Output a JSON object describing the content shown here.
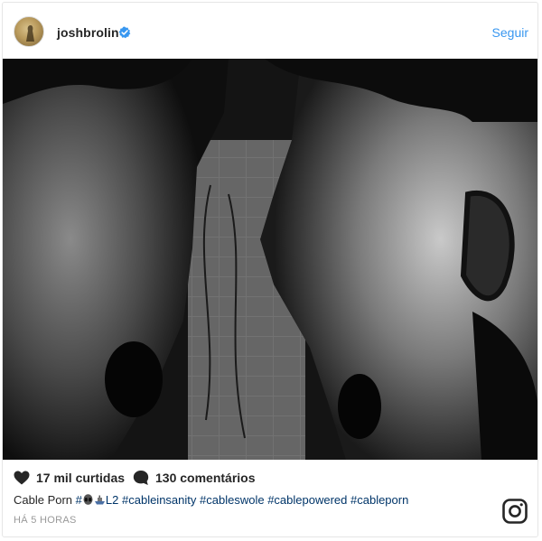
{
  "post": {
    "username": "joshbrolin",
    "verified": true,
    "follow_label": "Seguir",
    "photo_alt": "Black and white image of two screaming faces facing each other",
    "likes": "17 mil curtidas",
    "comments": "130 comentários",
    "caption": {
      "text": "Cable Porn",
      "hashtag_prefix": "#",
      "emoji_tag_suffix": "L2",
      "hashtags": [
        "#cableinsanity",
        "#cableswole",
        "#cablepowered",
        "#cableporn"
      ]
    },
    "timestamp": "HÁ 5 HORAS"
  },
  "icons": {
    "verified": "verified-badge-icon",
    "like": "heart-icon",
    "comment": "comment-bubble-icon",
    "brand": "instagram-logo-icon"
  },
  "colors": {
    "link_blue": "#3897f0",
    "hashtag_blue": "#003569",
    "text": "#262626",
    "muted": "#999999"
  }
}
